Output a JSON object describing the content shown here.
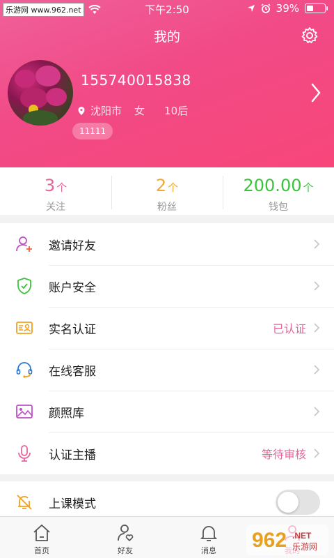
{
  "status_bar": {
    "watermark": "乐游网 www.962.net",
    "time": "下午2:50",
    "battery": "39%",
    "battery_level": 0.39
  },
  "header": {
    "title": "我的",
    "phone": "155740015838",
    "city": "沈阳市",
    "gender": "女",
    "age_group": "10后",
    "tag": "11111"
  },
  "stats": [
    {
      "value": "3",
      "unit": "个",
      "label": "关注",
      "color": "#e5649a"
    },
    {
      "value": "2",
      "unit": "个",
      "label": "粉丝",
      "color": "#f0a830"
    },
    {
      "value": "200.00",
      "unit": "个",
      "label": "钱包",
      "color": "#3bc43b"
    }
  ],
  "menu": [
    {
      "label": "邀请好友",
      "icon": "add-user-icon",
      "status": ""
    },
    {
      "label": "账户安全",
      "icon": "shield-check-icon",
      "status": ""
    },
    {
      "label": "实名认证",
      "icon": "id-card-icon",
      "status": "已认证"
    },
    {
      "label": "在线客服",
      "icon": "headset-icon",
      "status": ""
    },
    {
      "label": "颜照库",
      "icon": "image-icon",
      "status": ""
    },
    {
      "label": "认证主播",
      "icon": "microphone-icon",
      "status": "等待审核"
    }
  ],
  "class_mode": {
    "label": "上课模式",
    "icon": "bell-off-icon",
    "enabled": false
  },
  "tabs": [
    {
      "label": "首页",
      "icon": "home-icon",
      "active": false
    },
    {
      "label": "好友",
      "icon": "friend-heart-icon",
      "active": false
    },
    {
      "label": "消息",
      "icon": "bell-icon",
      "active": false
    },
    {
      "label": "我的",
      "icon": "profile-icon",
      "active": true
    }
  ],
  "watermark_logo": "962 乐游网",
  "colors": {
    "accent": "#e5649a",
    "header_start": "#f0609a",
    "header_end": "#f8467a"
  }
}
